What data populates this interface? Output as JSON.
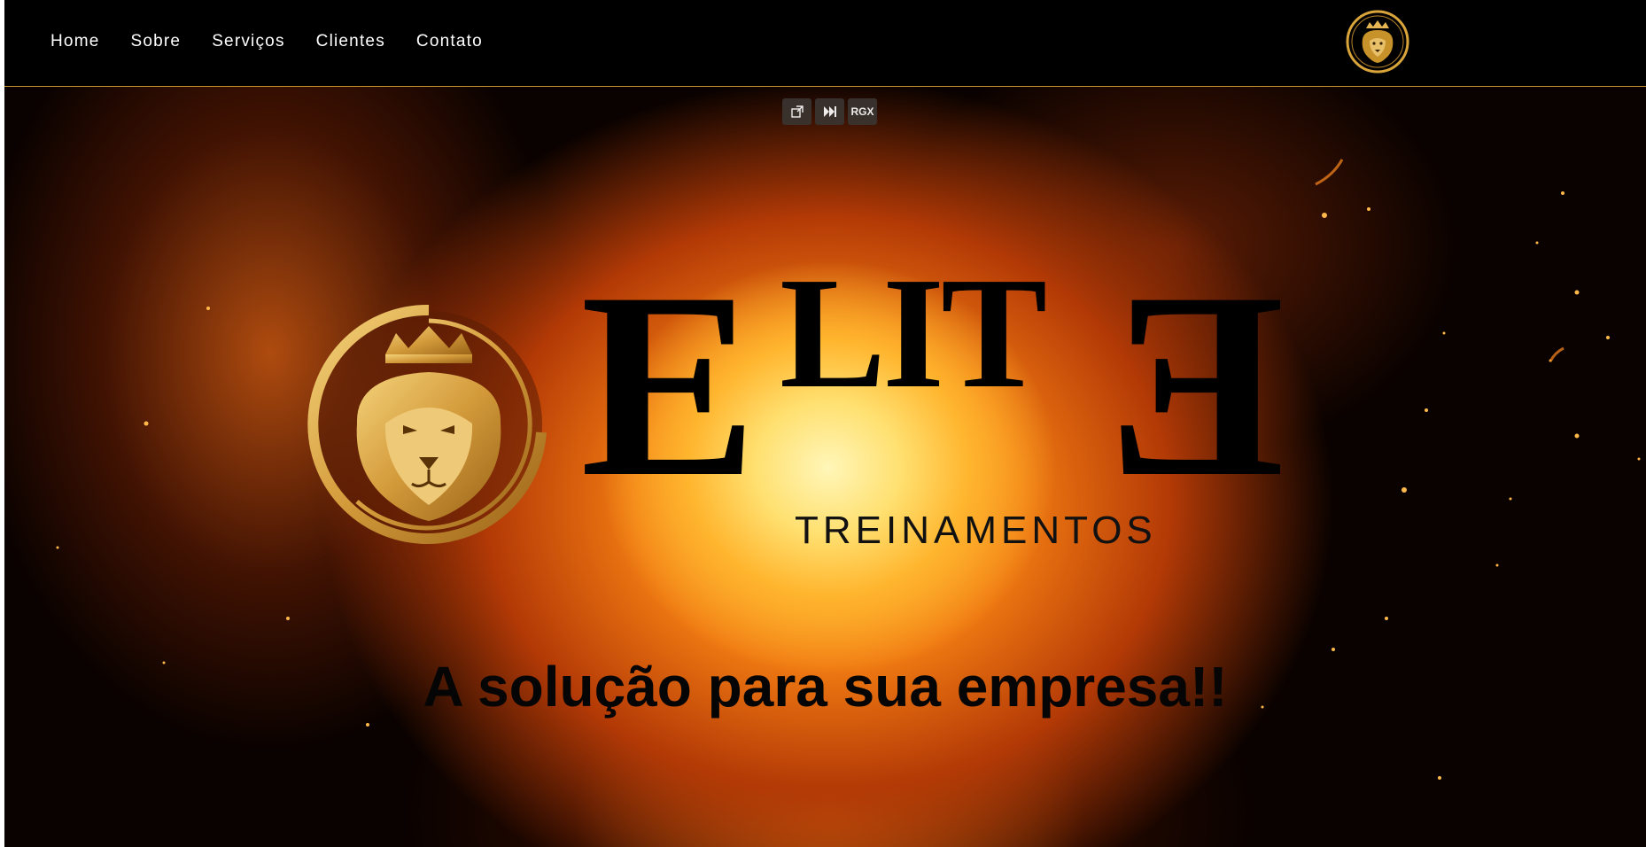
{
  "nav": {
    "items": [
      {
        "label": "Home"
      },
      {
        "label": "Sobre"
      },
      {
        "label": "Serviços"
      },
      {
        "label": "Clientes"
      },
      {
        "label": "Contato"
      }
    ],
    "logo_icon": "lion-crown-icon"
  },
  "video_controls": {
    "popout_icon": "popout-icon",
    "skip_icon": "skip-forward-icon",
    "rgx_label": "RGX"
  },
  "hero": {
    "brand_first": "E",
    "brand_middle": "LIT",
    "brand_last": "E",
    "subtitle": "TREINAMENTOS",
    "tagline": "A solução para sua empresa!!",
    "logo_icon": "lion-crown-icon"
  },
  "colors": {
    "gold": "#c8922a",
    "background": "#000000",
    "fire": "#ffb52e"
  }
}
